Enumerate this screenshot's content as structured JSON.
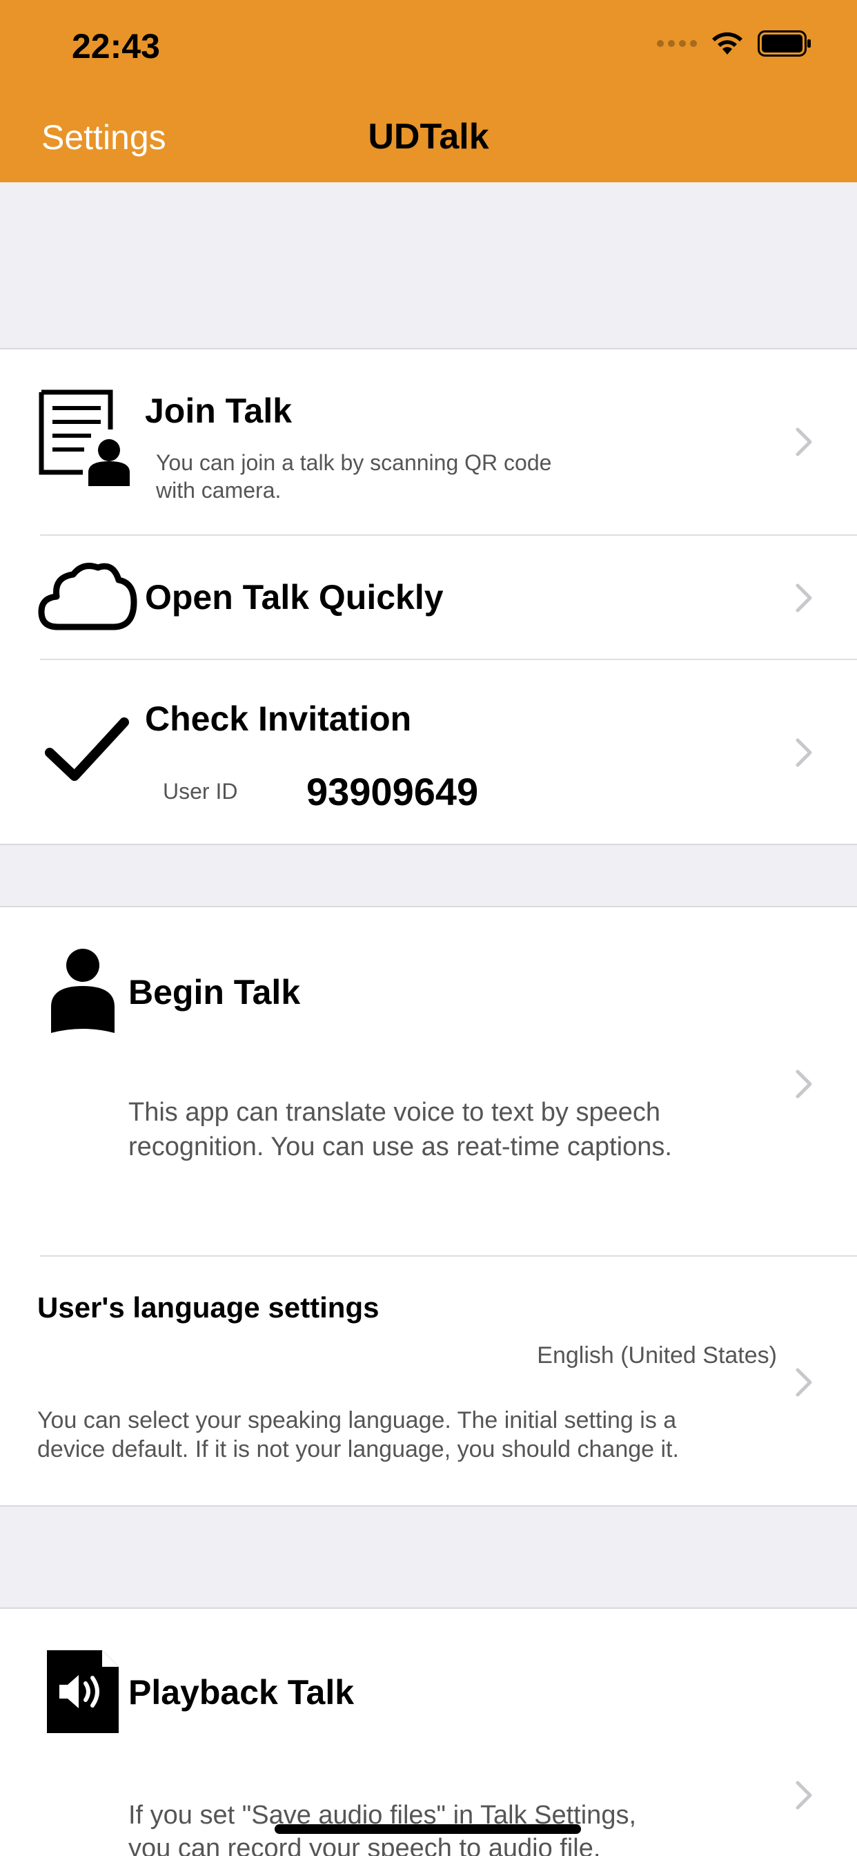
{
  "status": {
    "time": "22:43"
  },
  "nav": {
    "back_label": "Settings",
    "title": "UDTalk"
  },
  "section1": {
    "join": {
      "title": "Join Talk",
      "subtitle_line1": "You can join a talk by scanning QR code",
      "subtitle_line2": "with camera."
    },
    "open_quick": {
      "title": "Open Talk Quickly"
    },
    "check": {
      "title": "Check Invitation",
      "user_id_label": "User ID",
      "user_id_value": "93909649"
    }
  },
  "section2": {
    "begin": {
      "title": "Begin Talk",
      "desc_line1": "This app can translate voice to text by speech",
      "desc_line2": "recognition. You can use as reat-time captions."
    },
    "language": {
      "title": "User's language settings",
      "value": "English (United States)",
      "desc_line1": "You can select your speaking language. The initial setting is a",
      "desc_line2": "device default. If it is not your language, you should change it."
    }
  },
  "section3": {
    "playback": {
      "title": "Playback Talk",
      "desc_line1": "If you set \"Save audio files\" in Talk Settings,",
      "desc_line2": "you can record your speech to audio file."
    }
  },
  "icons": {
    "signal": "cellular-signal-icon",
    "wifi": "wifi-icon",
    "battery": "battery-icon",
    "join": "document-person-icon",
    "open": "cloud-icon",
    "check": "checkmark-icon",
    "begin": "person-icon",
    "playback": "audio-file-icon",
    "chevron": "chevron-right-icon"
  },
  "colors": {
    "nav_background": "#e89428",
    "group_background": "#efeff4",
    "chevron": "#c7c7cc"
  }
}
